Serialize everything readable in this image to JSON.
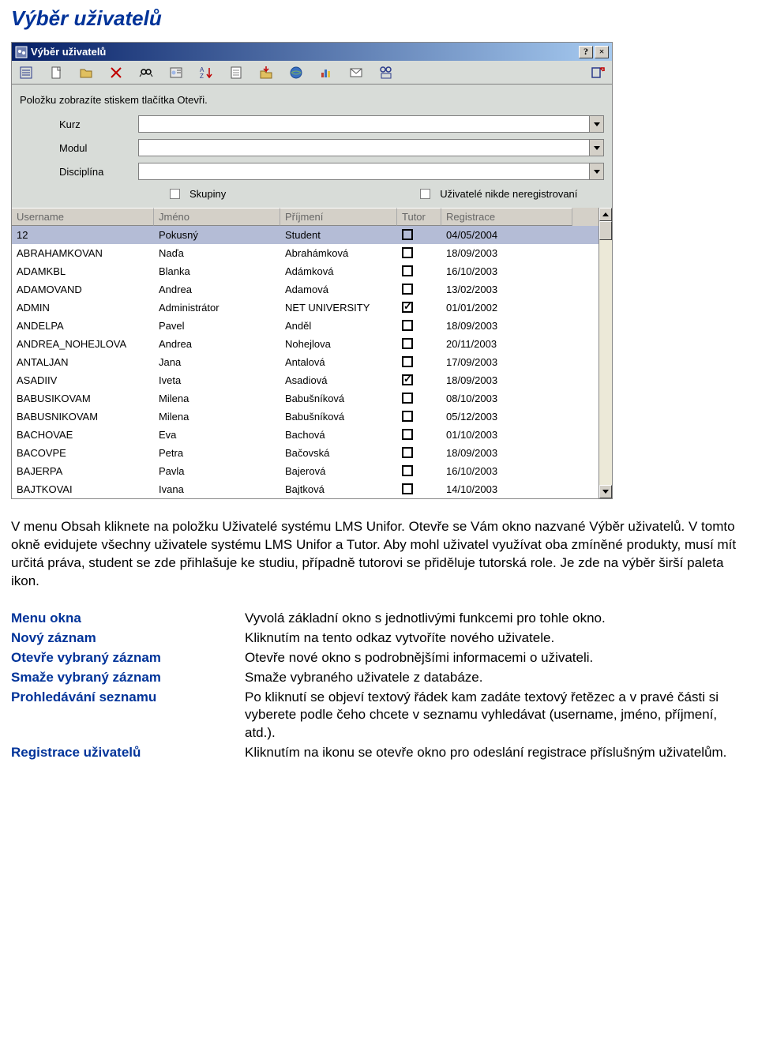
{
  "page_title": "Výběr uživatelů",
  "dialog": {
    "title": "Výběr uživatelů",
    "help_btn": "?",
    "close_btn": "×",
    "hint": "Položku zobrazíte stiskem tlačítka Otevři.",
    "filters": {
      "kurz_label": "Kurz",
      "modul_label": "Modul",
      "disciplina_label": "Disciplína",
      "skupiny_label": "Skupiny",
      "nereg_label": "Uživatelé nikde neregistrovaní"
    },
    "columns": {
      "username": "Username",
      "jmeno": "Jméno",
      "prijmeni": "Příjmení",
      "tutor": "Tutor",
      "registrace": "Registrace"
    },
    "rows": [
      {
        "username": "12",
        "jmeno": "Pokusný",
        "prijmeni": "Student",
        "tutor": false,
        "registrace": "04/05/2004",
        "selected": true
      },
      {
        "username": "ABRAHAMKOVAN",
        "jmeno": "Naďa",
        "prijmeni": "Abrahámková",
        "tutor": false,
        "registrace": "18/09/2003"
      },
      {
        "username": "ADAMKBL",
        "jmeno": "Blanka",
        "prijmeni": "Adámková",
        "tutor": false,
        "registrace": "16/10/2003"
      },
      {
        "username": "ADAMOVAND",
        "jmeno": "Andrea",
        "prijmeni": "Adamová",
        "tutor": false,
        "registrace": "13/02/2003"
      },
      {
        "username": "ADMIN",
        "jmeno": "Administrátor",
        "prijmeni": "NET UNIVERSITY",
        "tutor": true,
        "registrace": "01/01/2002"
      },
      {
        "username": "ANDELPA",
        "jmeno": "Pavel",
        "prijmeni": "Anděl",
        "tutor": false,
        "registrace": "18/09/2003"
      },
      {
        "username": "ANDREA_NOHEJLOVA",
        "jmeno": "Andrea",
        "prijmeni": "Nohejlova",
        "tutor": false,
        "registrace": "20/11/2003"
      },
      {
        "username": "ANTALJAN",
        "jmeno": "Jana",
        "prijmeni": "Antalová",
        "tutor": false,
        "registrace": "17/09/2003"
      },
      {
        "username": "ASADIIV",
        "jmeno": "Iveta",
        "prijmeni": "Asadiová",
        "tutor": true,
        "registrace": "18/09/2003"
      },
      {
        "username": "BABUSIKOVAM",
        "jmeno": "Milena",
        "prijmeni": "Babušníková",
        "tutor": false,
        "registrace": "08/10/2003"
      },
      {
        "username": "BABUSNIKOVAM",
        "jmeno": "Milena",
        "prijmeni": "Babušníková",
        "tutor": false,
        "registrace": "05/12/2003"
      },
      {
        "username": "BACHOVAE",
        "jmeno": "Eva",
        "prijmeni": "Bachová",
        "tutor": false,
        "registrace": "01/10/2003"
      },
      {
        "username": "BACOVPE",
        "jmeno": "Petra",
        "prijmeni": "Bačovská",
        "tutor": false,
        "registrace": "18/09/2003"
      },
      {
        "username": "BAJERPA",
        "jmeno": "Pavla",
        "prijmeni": "Bajerová",
        "tutor": false,
        "registrace": "16/10/2003"
      },
      {
        "username": "BAJTKOVAI",
        "jmeno": "Ivana",
        "prijmeni": "Bajtková",
        "tutor": false,
        "registrace": "14/10/2003"
      }
    ],
    "toolbar_icons": [
      "menu-icon",
      "new-icon",
      "open-icon",
      "delete-icon",
      "search-icon",
      "registrace-icon",
      "sort-icon",
      "properties-icon",
      "export-icon",
      "web-icon",
      "stats-icon",
      "email-icon",
      "viewusers-icon",
      "exit-icon"
    ]
  },
  "paragraph": "V menu Obsah kliknete na položku Uživatelé systému LMS Unifor. Otevře se Vám okno nazvané Výběr uživatelů. V tomto okně evidujete všechny uživatele systému LMS Unifor a Tutor. Aby mohl uživatel využívat oba zmíněné produkty, musí mít určitá práva, student se zde přihlašuje ke studiu, případně tutorovi se přiděluje tutorská role. Je zde na výběr širší paleta ikon.",
  "definitions": [
    {
      "term": "Menu okna",
      "desc": "Vyvolá základní okno s jednotlivými funkcemi pro tohle okno."
    },
    {
      "term": "Nový záznam",
      "desc": "Kliknutím na tento odkaz vytvoříte nového uživatele."
    },
    {
      "term": "Otevře vybraný záznam",
      "desc": "Otevře nové okno s podrobnějšími informacemi o uživateli."
    },
    {
      "term": "Smaže vybraný záznam",
      "desc": "Smaže vybraného uživatele z databáze."
    },
    {
      "term": "Prohledávání seznamu",
      "desc": "Po kliknutí se objeví textový řádek kam zadáte textový řetězec a v pravé části si vyberete podle čeho chcete v seznamu vyhledávat (username, jméno, příjmení, atd.)."
    },
    {
      "term": "Registrace uživatelů",
      "desc": "Kliknutím na ikonu se otevře okno pro odeslání registrace příslušným uživatelům."
    }
  ]
}
